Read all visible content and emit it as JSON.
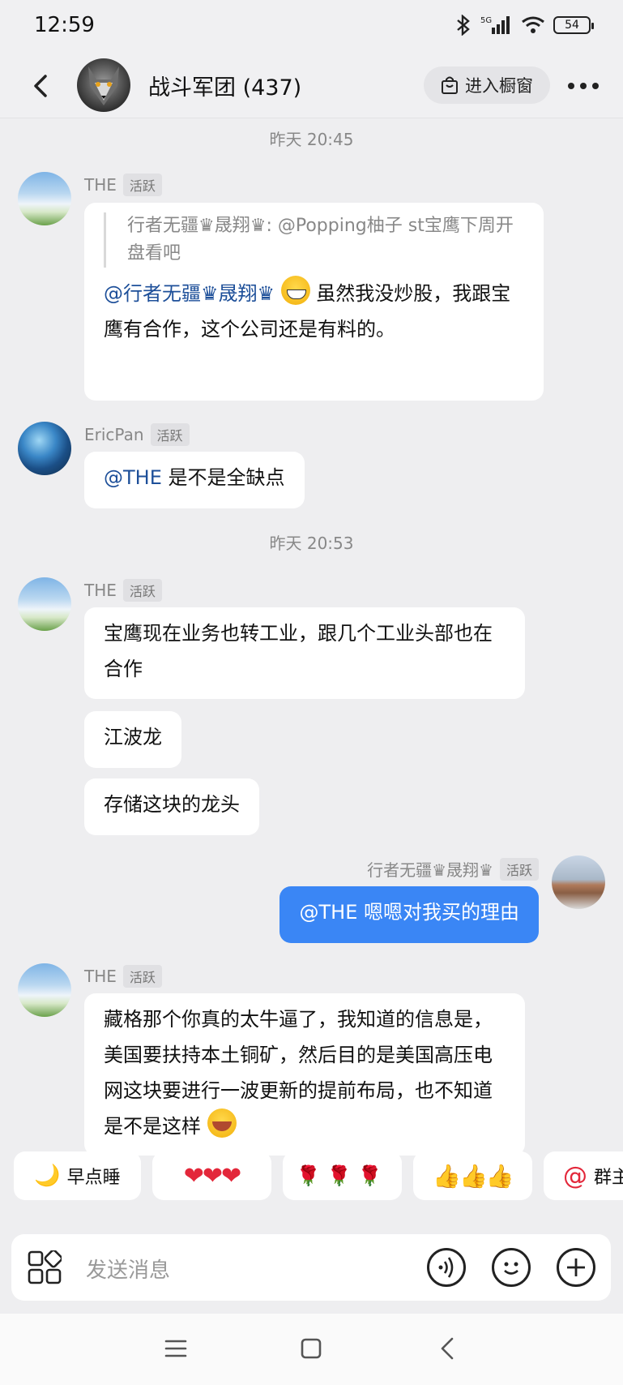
{
  "status_bar": {
    "time": "12:59",
    "network": "5G",
    "battery": "54"
  },
  "header": {
    "title": "战斗军团 (437)",
    "shop_label": "进入橱窗"
  },
  "messages": {
    "ts1": "昨天 20:45",
    "m1": {
      "sender": "THE",
      "badge": "活跃",
      "quote": "行者无疆♛晟翔♛: @Popping柚子 st宝鹰下周开盘看吧",
      "mention": "@行者无疆♛晟翔♛",
      "text": "虽然我没炒股，我跟宝鹰有合作，这个公司还是有料的。"
    },
    "m2": {
      "sender": "EricPan",
      "badge": "活跃",
      "mention": "@THE",
      "text": " 是不是全缺点"
    },
    "ts2": "昨天 20:53",
    "m3": {
      "sender": "THE",
      "badge": "活跃",
      "text1": "宝鹰现在业务也转工业，跟几个工业头部也在合作",
      "text2": "江波龙",
      "text3": "存储这块的龙头"
    },
    "m4": {
      "sender": "行者无疆♛晟翔♛",
      "badge": "活跃",
      "mention": "@THE",
      "text": " 嗯嗯对我买的理由"
    },
    "m5": {
      "sender": "THE",
      "badge": "活跃",
      "text": "藏格那个你真的太牛逼了，我知道的信息是，美国要扶持本土铜矿，然后目的是美国高压电网这块要进行一波更新的提前布局，也不知道是不是这样"
    }
  },
  "quick_replies": {
    "chip1": "早点睡",
    "chip2": "❤❤❤",
    "chip3": "🌹🌹🌹",
    "chip4": "👍👍👍",
    "chip5": "群主"
  },
  "input": {
    "placeholder": "发送消息"
  }
}
